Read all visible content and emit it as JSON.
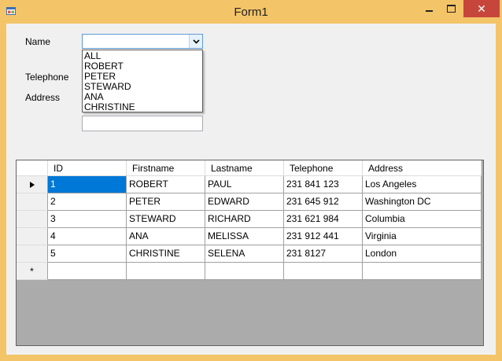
{
  "window": {
    "title": "Form1",
    "close_glyph": "✕",
    "icons": [
      "app-icon",
      "minimize-icon",
      "maximize-icon",
      "close-icon"
    ]
  },
  "form": {
    "name_label": "Name",
    "telephone_label": "Telephone",
    "address_label": "Address",
    "name_combo": {
      "value": "",
      "arrow_icon": "chevron-down-icon",
      "options": [
        "ALL",
        "ROBERT",
        "PETER",
        "STEWARD",
        "ANA",
        "CHRISTINE"
      ]
    },
    "telephone_value": "",
    "address_value": ""
  },
  "grid": {
    "columns": [
      "ID",
      "Firstname",
      "Lastname",
      "Telephone",
      "Address"
    ],
    "rows": [
      [
        "1",
        "ROBERT",
        "PAUL",
        "231 841 123",
        "Los Angeles"
      ],
      [
        "2",
        "PETER",
        "EDWARD",
        "231 645 912",
        "Washington DC"
      ],
      [
        "3",
        "STEWARD",
        "RICHARD",
        "231 621 984",
        "Columbia"
      ],
      [
        "4",
        "ANA",
        "MELISSA",
        "231 912 441",
        "Virginia"
      ],
      [
        "5",
        "CHRISTINE",
        "SELENA",
        "231 8127",
        "London"
      ]
    ],
    "current_row_indicator": "current-row-arrow-icon",
    "new_row_marker": "*",
    "selected_color": "#0078d7"
  },
  "colors": {
    "window_frame": "#f3c468",
    "client_bg": "#f0f0f0",
    "close_button": "#c7463c",
    "grid_empty_area": "#ababab"
  }
}
